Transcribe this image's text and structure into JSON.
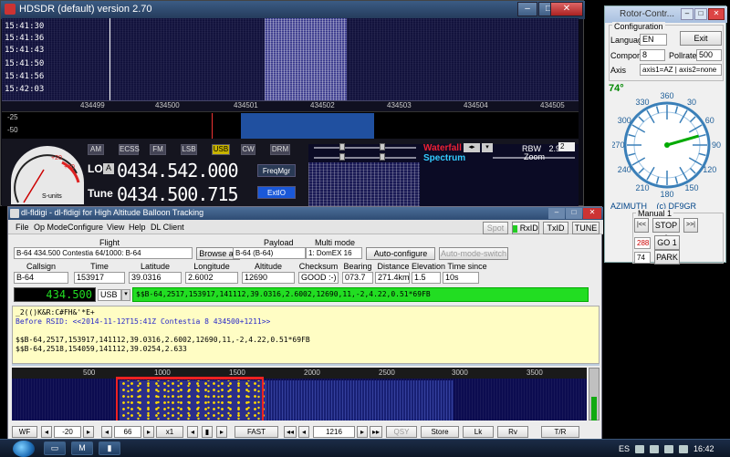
{
  "hdsdr": {
    "title": "HDSDR (default) version 2.70",
    "wf_times": [
      "15:41:30",
      "15:41:36",
      "15:41:43",
      "15:41:50",
      "15:41:56",
      "15:42:03"
    ],
    "freq_ticks": [
      "434499",
      "434500",
      "434501",
      "434502",
      "434503",
      "434504",
      "434505"
    ],
    "spectrum_levels": [
      "-25",
      "-50"
    ],
    "modes": [
      "AM",
      "ECSS",
      "FM",
      "LSB",
      "USB",
      "CW",
      "DRM"
    ],
    "active_mode": "USB",
    "lo_label": "LO",
    "lo_a": "A",
    "lo_value": "0434.542.000",
    "tune_label": "Tune",
    "tune_value": "0434.500.715",
    "freqmgr": "FreqMgr",
    "extio": "ExtIO",
    "smeter_ticks": [
      "+20",
      "+40"
    ],
    "smeter_label": "S-units",
    "waterfall_label": "Waterfall",
    "spectrum_label": "Spectrum",
    "rbw_label": "RBW",
    "rbw_value": "2.9 Hz",
    "rbw_num": "2",
    "zoom_label": "Zoom"
  },
  "rotor": {
    "title": "Rotor-Contr...",
    "config_label": "Configuration",
    "language_label": "Language",
    "language_value": "EN",
    "exit": "Exit",
    "comport_label": "Comport",
    "comport_value": "8",
    "pollrate_label": "Pollrate",
    "pollrate_value": "500",
    "axis_label": "Axis",
    "axis_value": "axis1=AZ | axis2=none",
    "current_deg": "74°",
    "compass_labels": [
      "360",
      "30",
      "60",
      "90",
      "120",
      "150",
      "180",
      "210",
      "240",
      "270",
      "300",
      "330"
    ],
    "azimuth_label": "AZIMUTH",
    "copyright": "(c) DF9GR",
    "manual_label": "Manual 1",
    "left_btn": "|<<",
    "stop": "STOP 1",
    "right_btn": ">>|",
    "goto_value": "288",
    "goto_btn": "GO 1",
    "park_value": "74",
    "park_btn": "PARK 1"
  },
  "fldigi": {
    "title": "dl-fldigi - dl-fldigi for High Altitude Balloon Tracking",
    "menu": [
      "File",
      "Op Mode",
      "Configure",
      "View",
      "Help",
      "DL Client"
    ],
    "top_right_btns": [
      "Spot",
      "RxID",
      "TxID",
      "TUNE"
    ],
    "flight_label": "Flight",
    "flight_value": "B-64 434.500 Contestia 64/1000: B-64",
    "browse_all": "Browse all",
    "payload_label": "Payload",
    "payload_value": "B-64 (B-64)",
    "multimode_label": "Multi mode",
    "multimode_value": "1: DomEX 16",
    "auto_configure": "Auto-configure",
    "auto_mode_switch": "Auto-mode-switch",
    "fields": {
      "headers": [
        "Callsign",
        "Time",
        "Latitude",
        "Longitude",
        "Altitude",
        "Checksum",
        "Bearing",
        "Distance",
        "Elevation",
        "Time since Rx"
      ],
      "values": [
        "B-64",
        "153917",
        "39.0316",
        "2.6002",
        "12690",
        "GOOD :-)",
        "073.7",
        "271.4km",
        "1.5",
        "10s"
      ]
    },
    "freq_display": "434.500",
    "mode_select": "USB",
    "sentence": "$$B-64,2517,153917,141112,39.0316,2.6002,12690,11,-2,4.22,0.51*69FB",
    "rx_lines": [
      "_2(()K&R:C#FH&'*E+",
      "Before RSID: <<2014-11-12T15:41Z Contestia 8 434500+1211>>",
      "",
      "$$B-64,2517,153917,141112,39.0316,2.6002,12690,11,-2,4.22,0.51*69FB",
      "$$B-64,2518,154059,141112,39.0254,2.633"
    ],
    "scale_ticks": [
      "500",
      "1000",
      "1500",
      "2000",
      "2500",
      "3000",
      "3500"
    ],
    "bottom": {
      "wf": "WF",
      "level": "-20",
      "range": "66",
      "zoom": "x1",
      "speed": "FAST",
      "freq": "1216",
      "qsy": "QSY",
      "store": "Store",
      "lk": "Lk",
      "rv": "Rv",
      "tr": "T/R"
    }
  },
  "taskbar": {
    "lang": "ES",
    "clock": "16:42"
  },
  "colors": {
    "accent_blue": "#1a58d8",
    "fldigi_green": "#22dd22",
    "rx_bg": "#fffdc4"
  }
}
